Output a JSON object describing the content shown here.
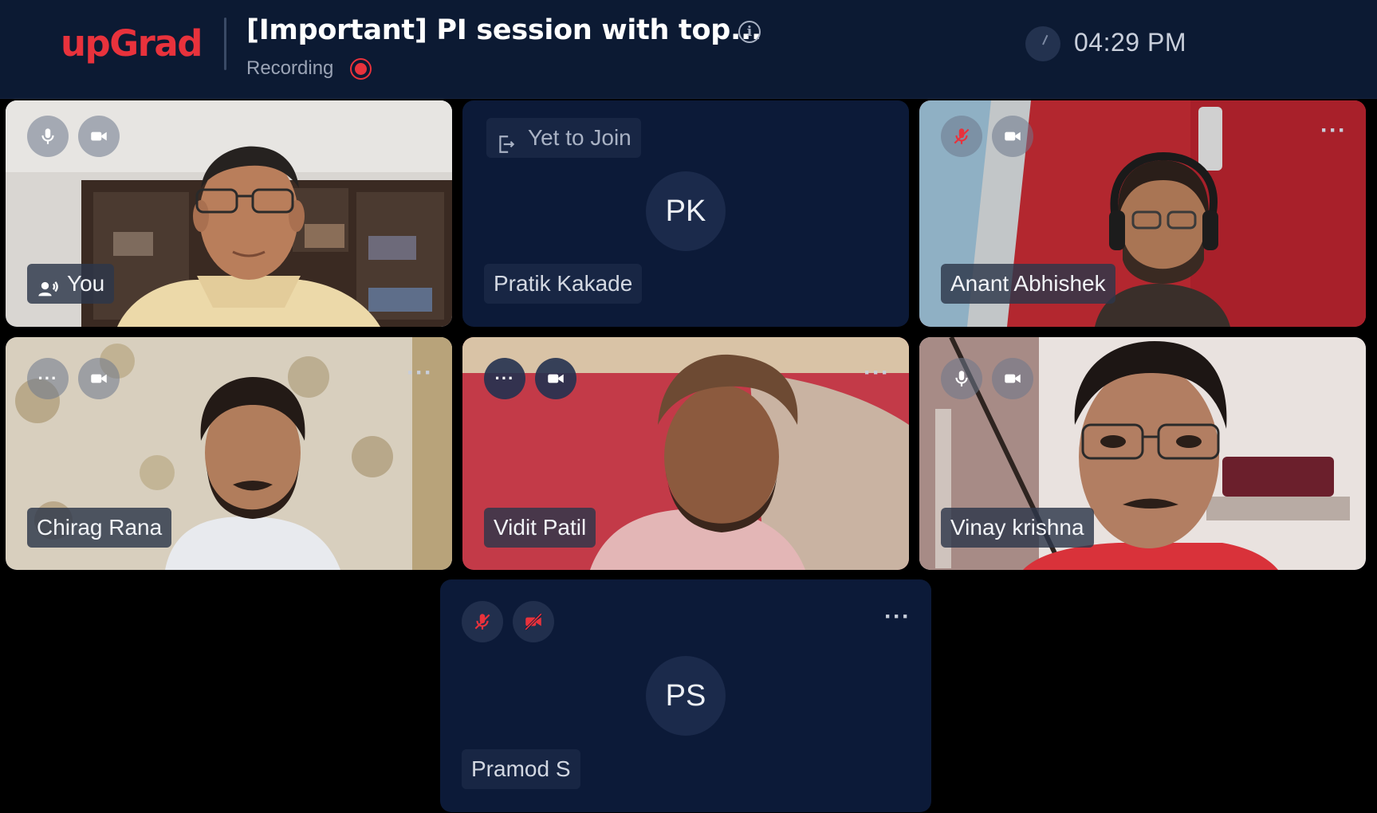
{
  "header": {
    "logo": "upGrad",
    "title": "[Important] PI session with top...",
    "info_icon": "info-icon",
    "recording_label": "Recording",
    "clock": "04:29 PM",
    "colors": {
      "bar": "#0c1a33",
      "brand": "#e8323c"
    }
  },
  "tiles": [
    {
      "name": "You",
      "status": "video",
      "mic": "on",
      "camera": "on",
      "speaking": true
    },
    {
      "name": "Pratik Kakade",
      "status": "Yet to Join",
      "initials": "PK"
    },
    {
      "name": "Anant Abhishek",
      "status": "video",
      "mic": "muted",
      "camera": "on",
      "menu": "..."
    },
    {
      "name": "Chirag Rana",
      "status": "video",
      "mic": "connecting",
      "camera": "on",
      "menu": "..."
    },
    {
      "name": "Vidit Patil",
      "status": "video",
      "mic": "connecting",
      "camera": "on",
      "menu": "..."
    },
    {
      "name": "Vinay krishna",
      "status": "video",
      "mic": "on",
      "camera": "on"
    },
    {
      "name": "Pramod S",
      "status": "audio-only",
      "mic": "muted",
      "camera": "off",
      "initials": "PS",
      "menu": "..."
    }
  ],
  "ellipsis": "···"
}
